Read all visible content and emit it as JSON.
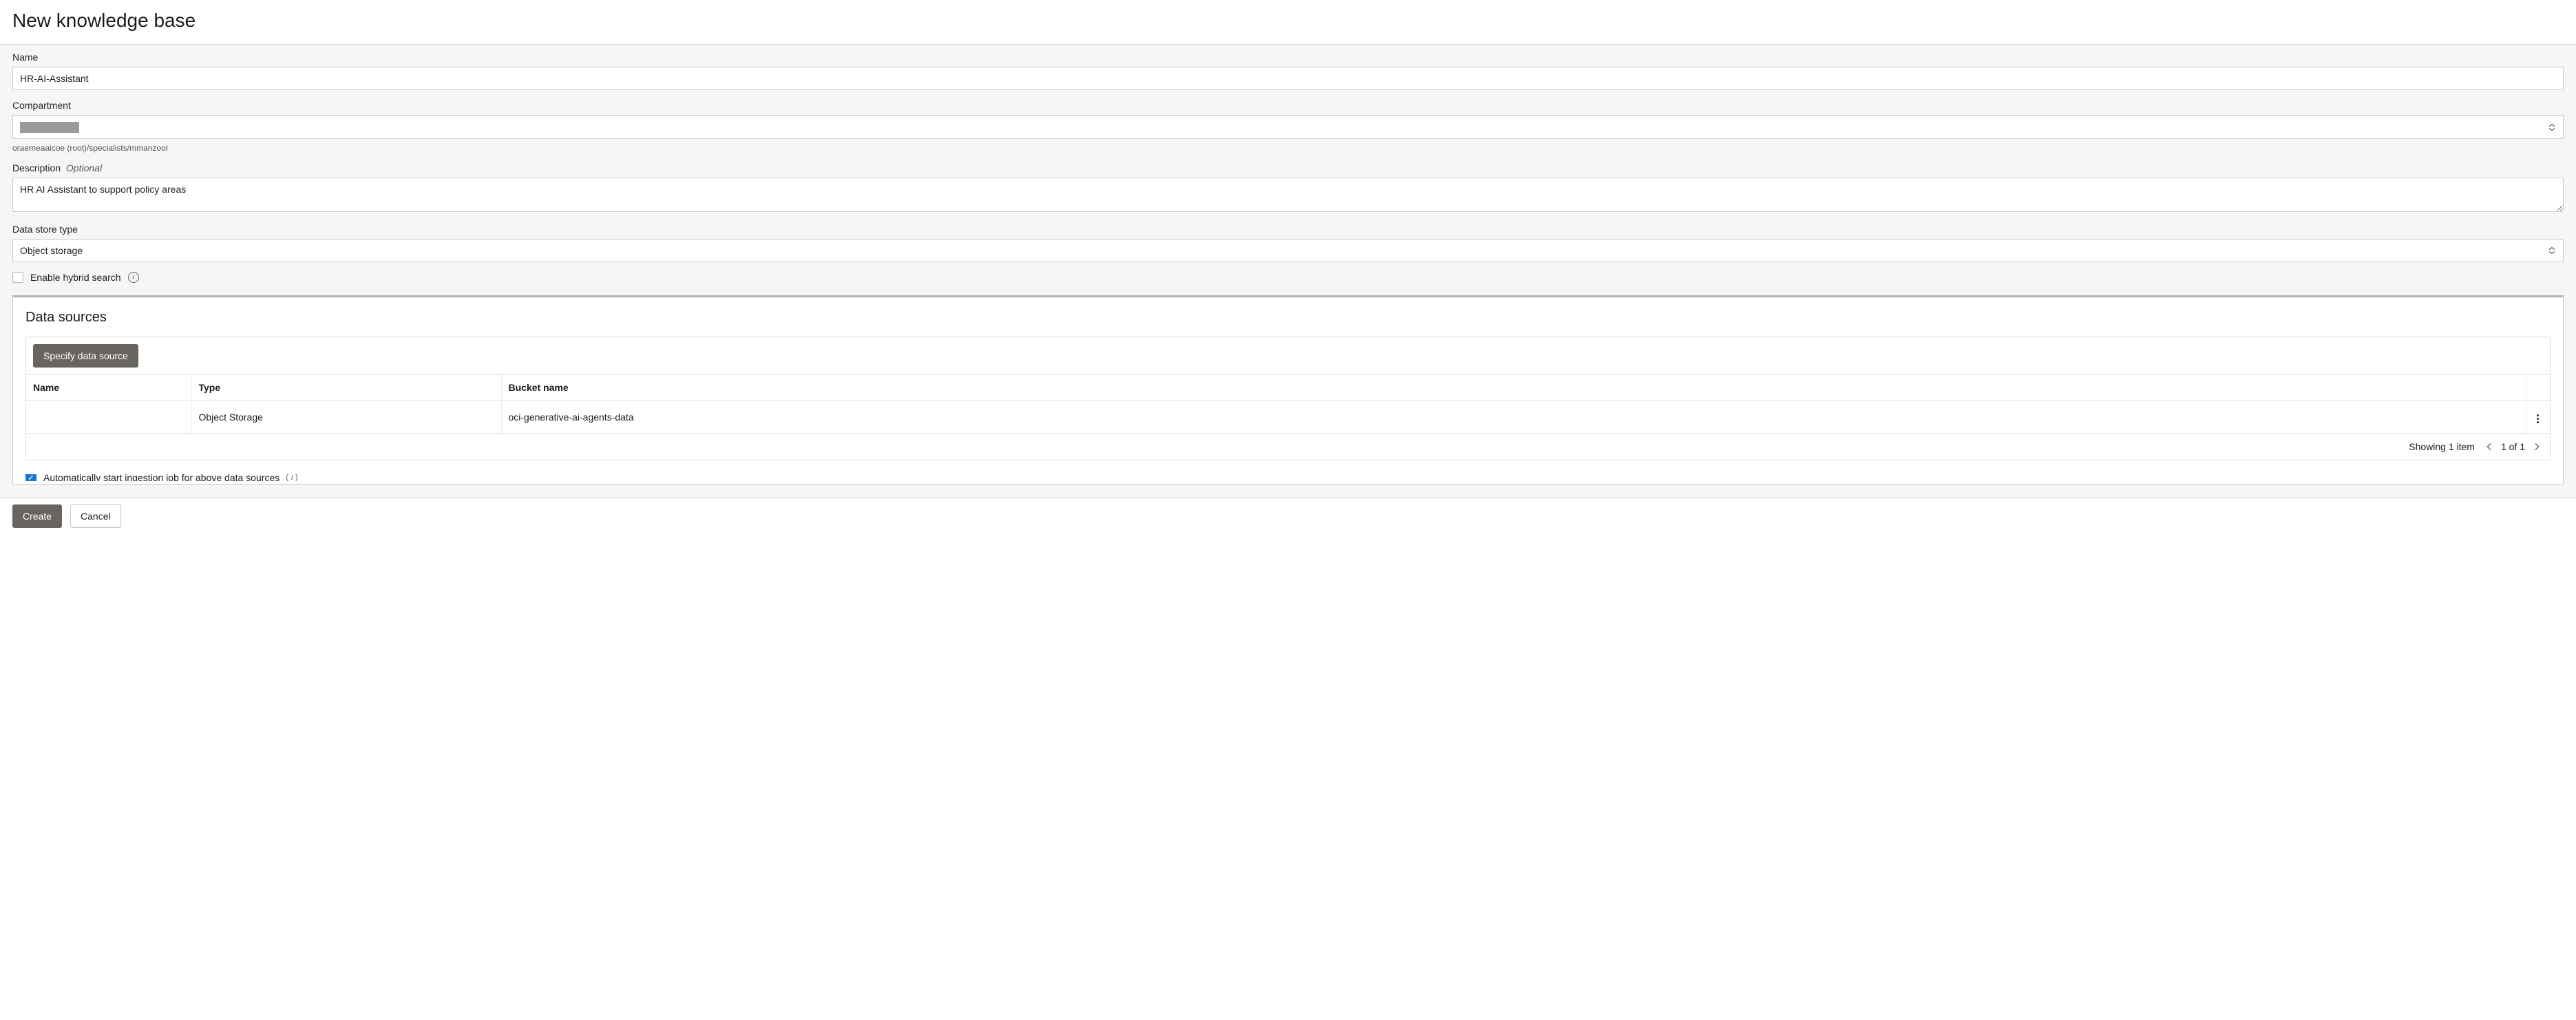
{
  "page": {
    "title": "New knowledge base"
  },
  "fields": {
    "name": {
      "label": "Name",
      "value": "HR-AI-Assistant"
    },
    "compartment": {
      "label": "Compartment",
      "path": "oraemeaaicoe (root)/specialists/mmanzoor"
    },
    "description": {
      "label": "Description",
      "optional": "Optional",
      "value": "HR AI Assistant to support policy areas"
    },
    "data_store_type": {
      "label": "Data store type",
      "value": "Object storage"
    },
    "hybrid_search": {
      "label": "Enable hybrid search",
      "checked": false
    },
    "auto_ingest": {
      "label": "Automatically start ingestion job for above data sources",
      "checked": true
    }
  },
  "data_sources": {
    "title": "Data sources",
    "specify_button": "Specify data source",
    "columns": {
      "name": "Name",
      "type": "Type",
      "bucket": "Bucket name"
    },
    "rows": [
      {
        "name": "",
        "type": "Object Storage",
        "bucket": "oci-generative-ai-agents-data"
      }
    ],
    "footer": {
      "showing": "Showing 1 item",
      "page": "1 of 1"
    }
  },
  "actions": {
    "create": "Create",
    "cancel": "Cancel"
  }
}
